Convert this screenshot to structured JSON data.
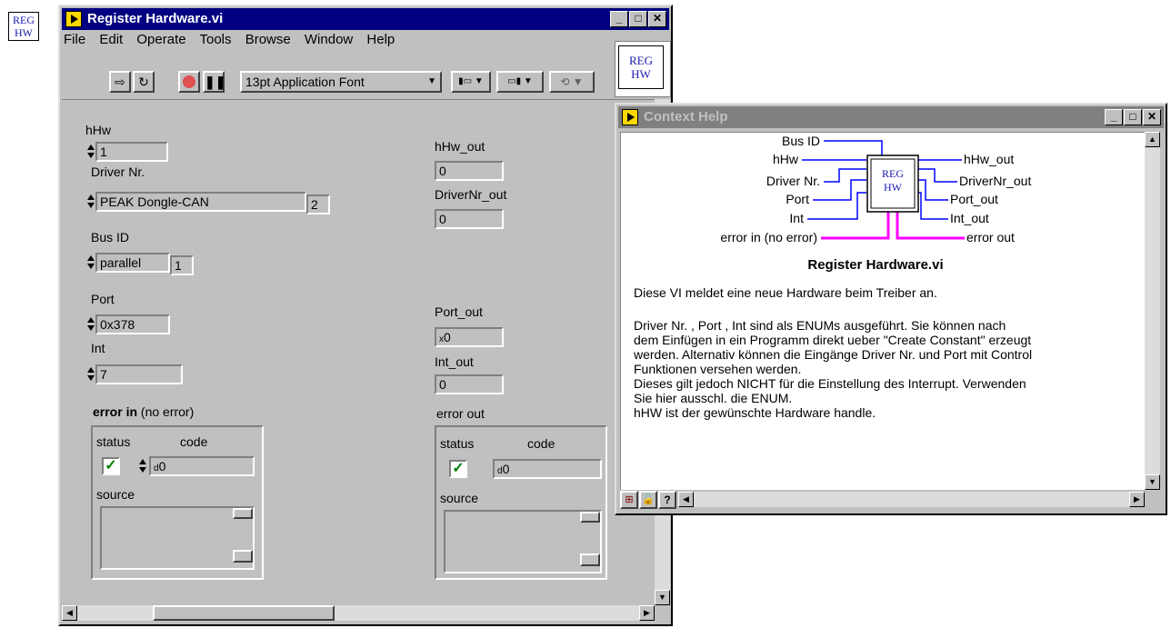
{
  "desktop_icon": {
    "line1": "REG",
    "line2": "HW"
  },
  "main_window": {
    "title": "Register Hardware.vi",
    "menu": [
      "File",
      "Edit",
      "Operate",
      "Tools",
      "Browse",
      "Window",
      "Help"
    ],
    "toolbar": {
      "font_select": "13pt Application Font"
    },
    "vi_icon": {
      "line1": "REG",
      "line2": "HW"
    },
    "panel": {
      "hhw_label": "hHw",
      "hhw_value": "1",
      "driver_label": "Driver Nr.",
      "driver_value": "PEAK Dongle-CAN",
      "driver_index": "2",
      "busid_label": "Bus ID",
      "busid_value": "parallel",
      "busid_index": "1",
      "port_label": "Port",
      "port_value": "0x378",
      "int_label": "Int",
      "int_value": "7",
      "hhw_out_label": "hHw_out",
      "hhw_out_value": "0",
      "drivernr_out_label": "DriverNr_out",
      "drivernr_out_value": "0",
      "port_out_label": "Port_out",
      "port_out_value": "0",
      "port_out_prefix": "x",
      "int_out_label": "Int_out",
      "int_out_value": "0",
      "error_in_label": "error in",
      "error_in_suffix": "(no error)",
      "error_in": {
        "status_label": "status",
        "code_label": "code",
        "code_value": "0",
        "code_prefix": "d",
        "source_label": "source"
      },
      "error_out_label": "error out",
      "error_out": {
        "status_label": "status",
        "code_label": "code",
        "code_value": "0",
        "code_prefix": "d",
        "source_label": "source"
      }
    }
  },
  "help_window": {
    "title": "Context Help",
    "connector": {
      "left_inputs": [
        "Bus ID",
        "hHw",
        "Driver Nr.",
        "Port",
        "Int",
        "error in (no error)"
      ],
      "right_outputs": [
        "hHw_out",
        "DriverNr_out",
        "Port_out",
        "Int_out",
        "error out"
      ],
      "icon_line1": "REG",
      "icon_line2": "HW",
      "wire_color": "#ff00ff",
      "wire_color_blue": "#0000ff"
    },
    "vi_name": "Register Hardware.vi",
    "description": [
      "Diese VI meldet eine neue Hardware beim Treiber an.",
      "",
      "Driver Nr. , Port , Int sind als ENUMs ausgeführt. Sie können nach",
      "dem Einfügen in ein Programm direkt ueber \"Create Constant\" erzeugt",
      "werden. Alternativ können die Eingänge Driver Nr. und Port mit Control",
      "Funktionen versehen werden.",
      "Dieses gilt jedoch NICHT für die Einstellung des Interrupt. Verwenden",
      "Sie hier ausschl. die ENUM.",
      "hHW ist der gewünschte Hardware handle."
    ]
  }
}
